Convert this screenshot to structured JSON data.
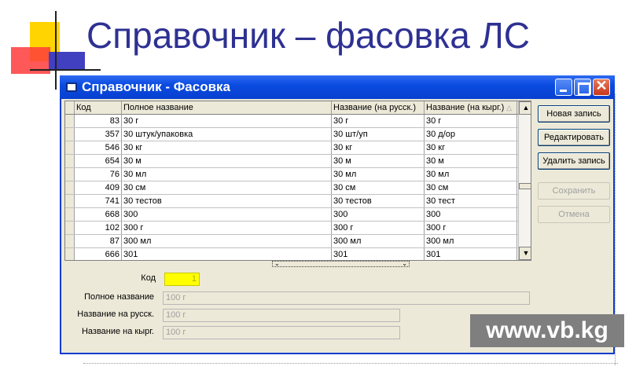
{
  "slide": {
    "title": "Справочник – фасовка ЛС",
    "watermark": "www.vb.kg"
  },
  "window": {
    "title": "Справочник - Фасовка"
  },
  "grid": {
    "columns": [
      "Код",
      "Полное название",
      "Название (на русск.)",
      "Название (на кырг.)"
    ],
    "rows": [
      {
        "kod": "83",
        "full": "30 г",
        "rus": "30 г",
        "kyr": "30 г"
      },
      {
        "kod": "357",
        "full": "30 штук/упаковка",
        "rus": "30 шт/уп",
        "kyr": "30 д/ор"
      },
      {
        "kod": "546",
        "full": "30 кг",
        "rus": "30 кг",
        "kyr": "30 кг"
      },
      {
        "kod": "654",
        "full": "30 м",
        "rus": "30 м",
        "kyr": "30 м"
      },
      {
        "kod": "76",
        "full": "30 мл",
        "rus": "30 мл",
        "kyr": "30 мл"
      },
      {
        "kod": "409",
        "full": "30 см",
        "rus": "30 см",
        "kyr": "30 см"
      },
      {
        "kod": "741",
        "full": "30 тестов",
        "rus": "30 тестов",
        "kyr": "30 тест"
      },
      {
        "kod": "668",
        "full": "300",
        "rus": "300",
        "kyr": "300"
      },
      {
        "kod": "102",
        "full": "300 г",
        "rus": "300 г",
        "kyr": "300 г"
      },
      {
        "kod": "87",
        "full": "300 мл",
        "rus": "300 мл",
        "kyr": "300 мл"
      },
      {
        "kod": "666",
        "full": "301",
        "rus": "301",
        "kyr": "301"
      }
    ]
  },
  "buttons": {
    "new_record": "Новая запись",
    "edit": "Редактировать",
    "delete": "Удалить запись",
    "save": "Сохранить",
    "cancel": "Отмена"
  },
  "form": {
    "kod_label": "Код",
    "kod_value": "1",
    "full_label": "Полное название",
    "full_value": "100 г",
    "rus_label": "Название на русск.",
    "rus_value": "100 г",
    "kyr_label": "Название на кырг.",
    "kyr_value": "100 г"
  },
  "colors": {
    "title": "#2e3192",
    "titlebar": "#0a4be0",
    "kod_field": "#ffff00"
  }
}
